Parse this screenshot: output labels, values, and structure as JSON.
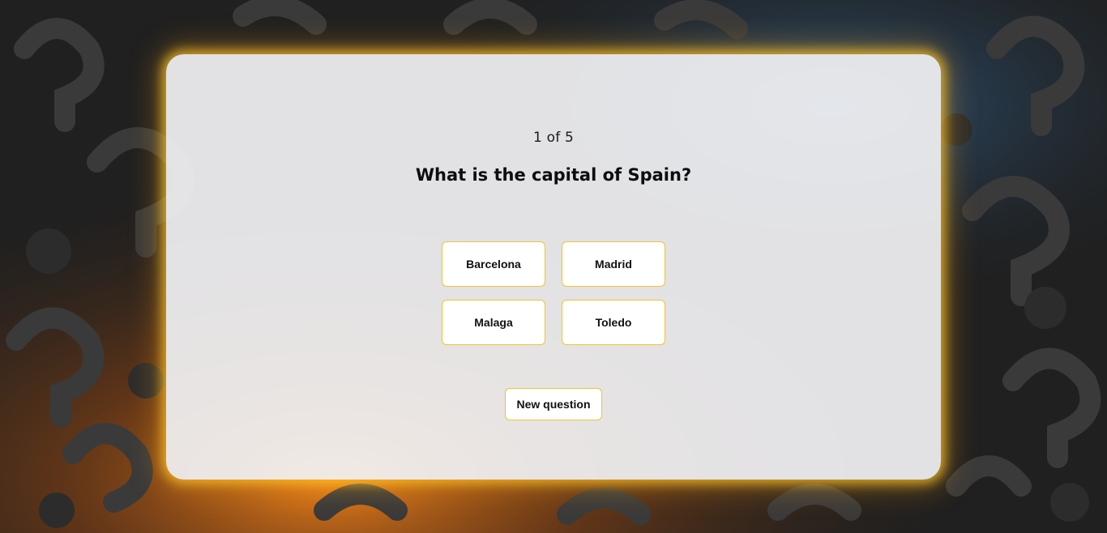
{
  "quiz": {
    "counter": "1 of 5",
    "question": "What is the capital of Spain?",
    "answers": [
      {
        "label": "Barcelona"
      },
      {
        "label": "Madrid"
      },
      {
        "label": "Malaga"
      },
      {
        "label": "Toledo"
      }
    ],
    "new_question_label": "New question"
  },
  "colors": {
    "accent_glow": "#ffc428",
    "button_border": "#f2c230",
    "card_background": "#f1f1f3",
    "page_background": "#1b1b1b"
  }
}
